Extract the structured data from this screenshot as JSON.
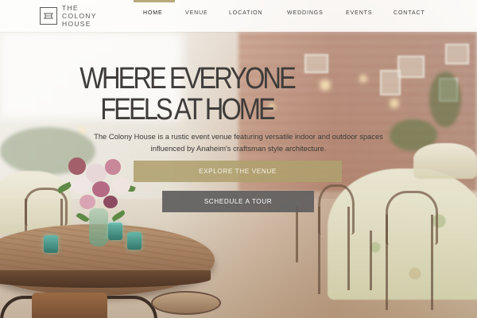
{
  "brand": {
    "logo_icon": "house-frame-icon",
    "name_line1": "THE",
    "name_line2": "COLONY",
    "name_line3": "HOUSE"
  },
  "nav": {
    "items": [
      {
        "label": "HOME",
        "active": true
      },
      {
        "label": "VENUE",
        "active": false
      },
      {
        "label": "LOCATION",
        "active": false
      },
      {
        "label": "WEDDINGS",
        "active": false
      },
      {
        "label": "EVENTS",
        "active": false
      },
      {
        "label": "CONTACT",
        "active": false
      }
    ]
  },
  "hero": {
    "title_line1": "WHERE EVERYONE",
    "title_line2": "FEELS AT HOME",
    "subtitle": "The Colony House is a rustic event venue featuring versatile indoor and outdoor spaces influenced by Anaheim's craftsman style architecture.",
    "primary_button": "EXPLORE THE VENUE",
    "secondary_button": "SCHEDULE A TOUR"
  },
  "colors": {
    "accent": "#b8a97a",
    "primary_button_bg": "#afa06e",
    "secondary_button_bg": "#605e5e",
    "header_bg": "#ffffff",
    "text_dark": "#3f3c3a"
  }
}
